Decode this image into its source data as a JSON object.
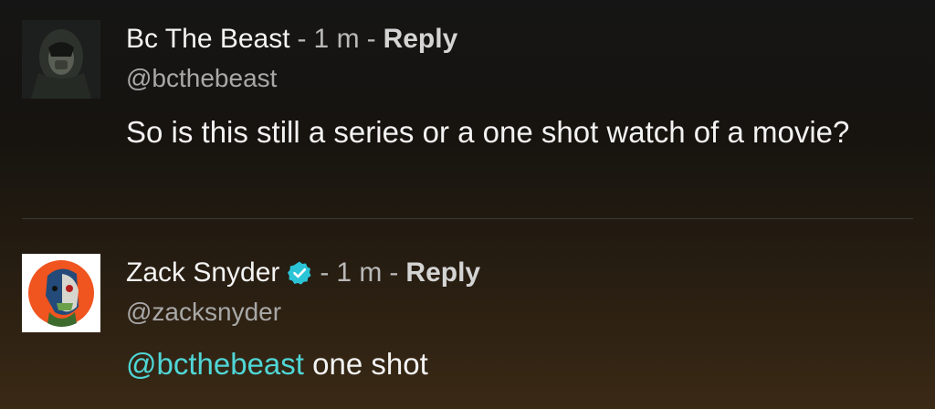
{
  "comments": [
    {
      "author": "Bc The Beast",
      "separator_1": "-",
      "time": "1 m",
      "separator_2": "-",
      "reply_label": "Reply",
      "handle": "@bcthebeast",
      "text": "So is this still a series or a one shot watch of a movie?"
    },
    {
      "author": "Zack Snyder",
      "verified": true,
      "separator_1": "-",
      "time": "1 m",
      "separator_2": "-",
      "reply_label": "Reply",
      "handle": "@zacksnyder",
      "mention": "@bcthebeast",
      "text": " one shot"
    }
  ],
  "colors": {
    "mention": "#4fd6d6",
    "verified_badge": "#2bc4d7"
  }
}
